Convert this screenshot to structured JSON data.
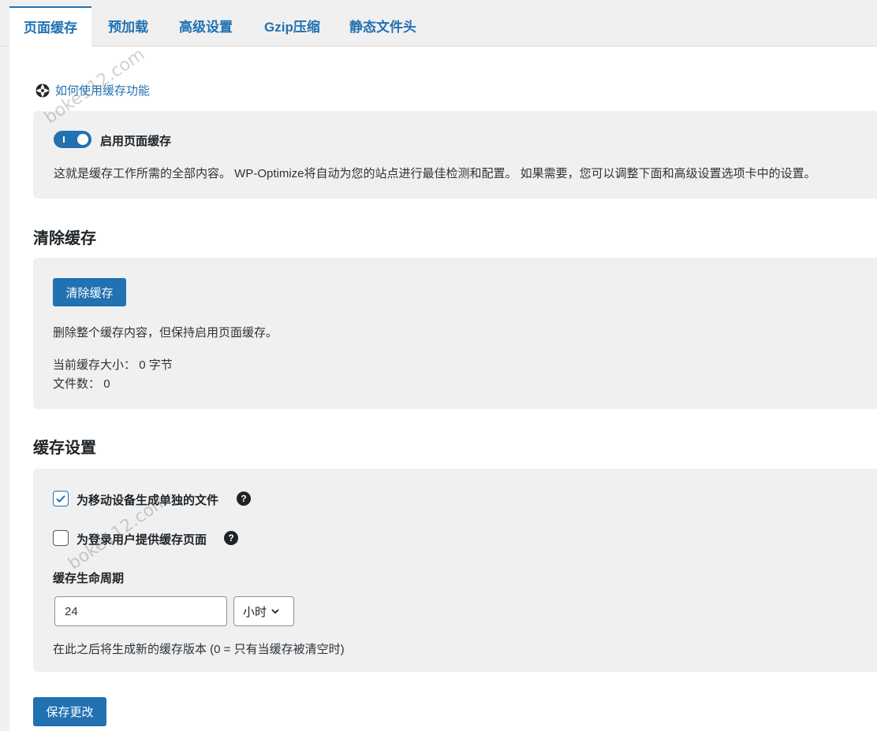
{
  "tabs": [
    {
      "label": "页面缓存",
      "active": true
    },
    {
      "label": "预加载"
    },
    {
      "label": "高级设置"
    },
    {
      "label": "Gzip压缩"
    },
    {
      "label": "静态文件头"
    }
  ],
  "watermark": "boke112.com",
  "help_link": {
    "label": "如何使用缓存功能"
  },
  "enable_panel": {
    "toggle_on": true,
    "toggle_label": "启用页面缓存",
    "description": "这就是缓存工作所需的全部内容。 WP-Optimize将自动为您的站点进行最佳检测和配置。 如果需要，您可以调整下面和高级设置选项卡中的设置。"
  },
  "purge_section": {
    "title": "清除缓存",
    "button_label": "清除缓存",
    "description": "删除整个缓存内容，但保持启用页面缓存。",
    "size_label": "当前缓存大小：",
    "size_value": "0 字节",
    "files_label": "文件数：",
    "files_value": "0"
  },
  "settings_section": {
    "title": "缓存设置",
    "mobile_label": "为移动设备生成单独的文件",
    "mobile_checked": true,
    "logged_in_label": "为登录用户提供缓存页面",
    "logged_in_checked": false,
    "lifespan_label": "缓存生命周期",
    "lifespan_value": "24",
    "lifespan_unit": "小时",
    "lifespan_help": "在此之后将生成新的缓存版本 (0 = 只有当缓存被清空时)"
  },
  "save_button_label": "保存更改",
  "colors": {
    "accent": "#2271b1",
    "panel": "#f0f0f1"
  }
}
